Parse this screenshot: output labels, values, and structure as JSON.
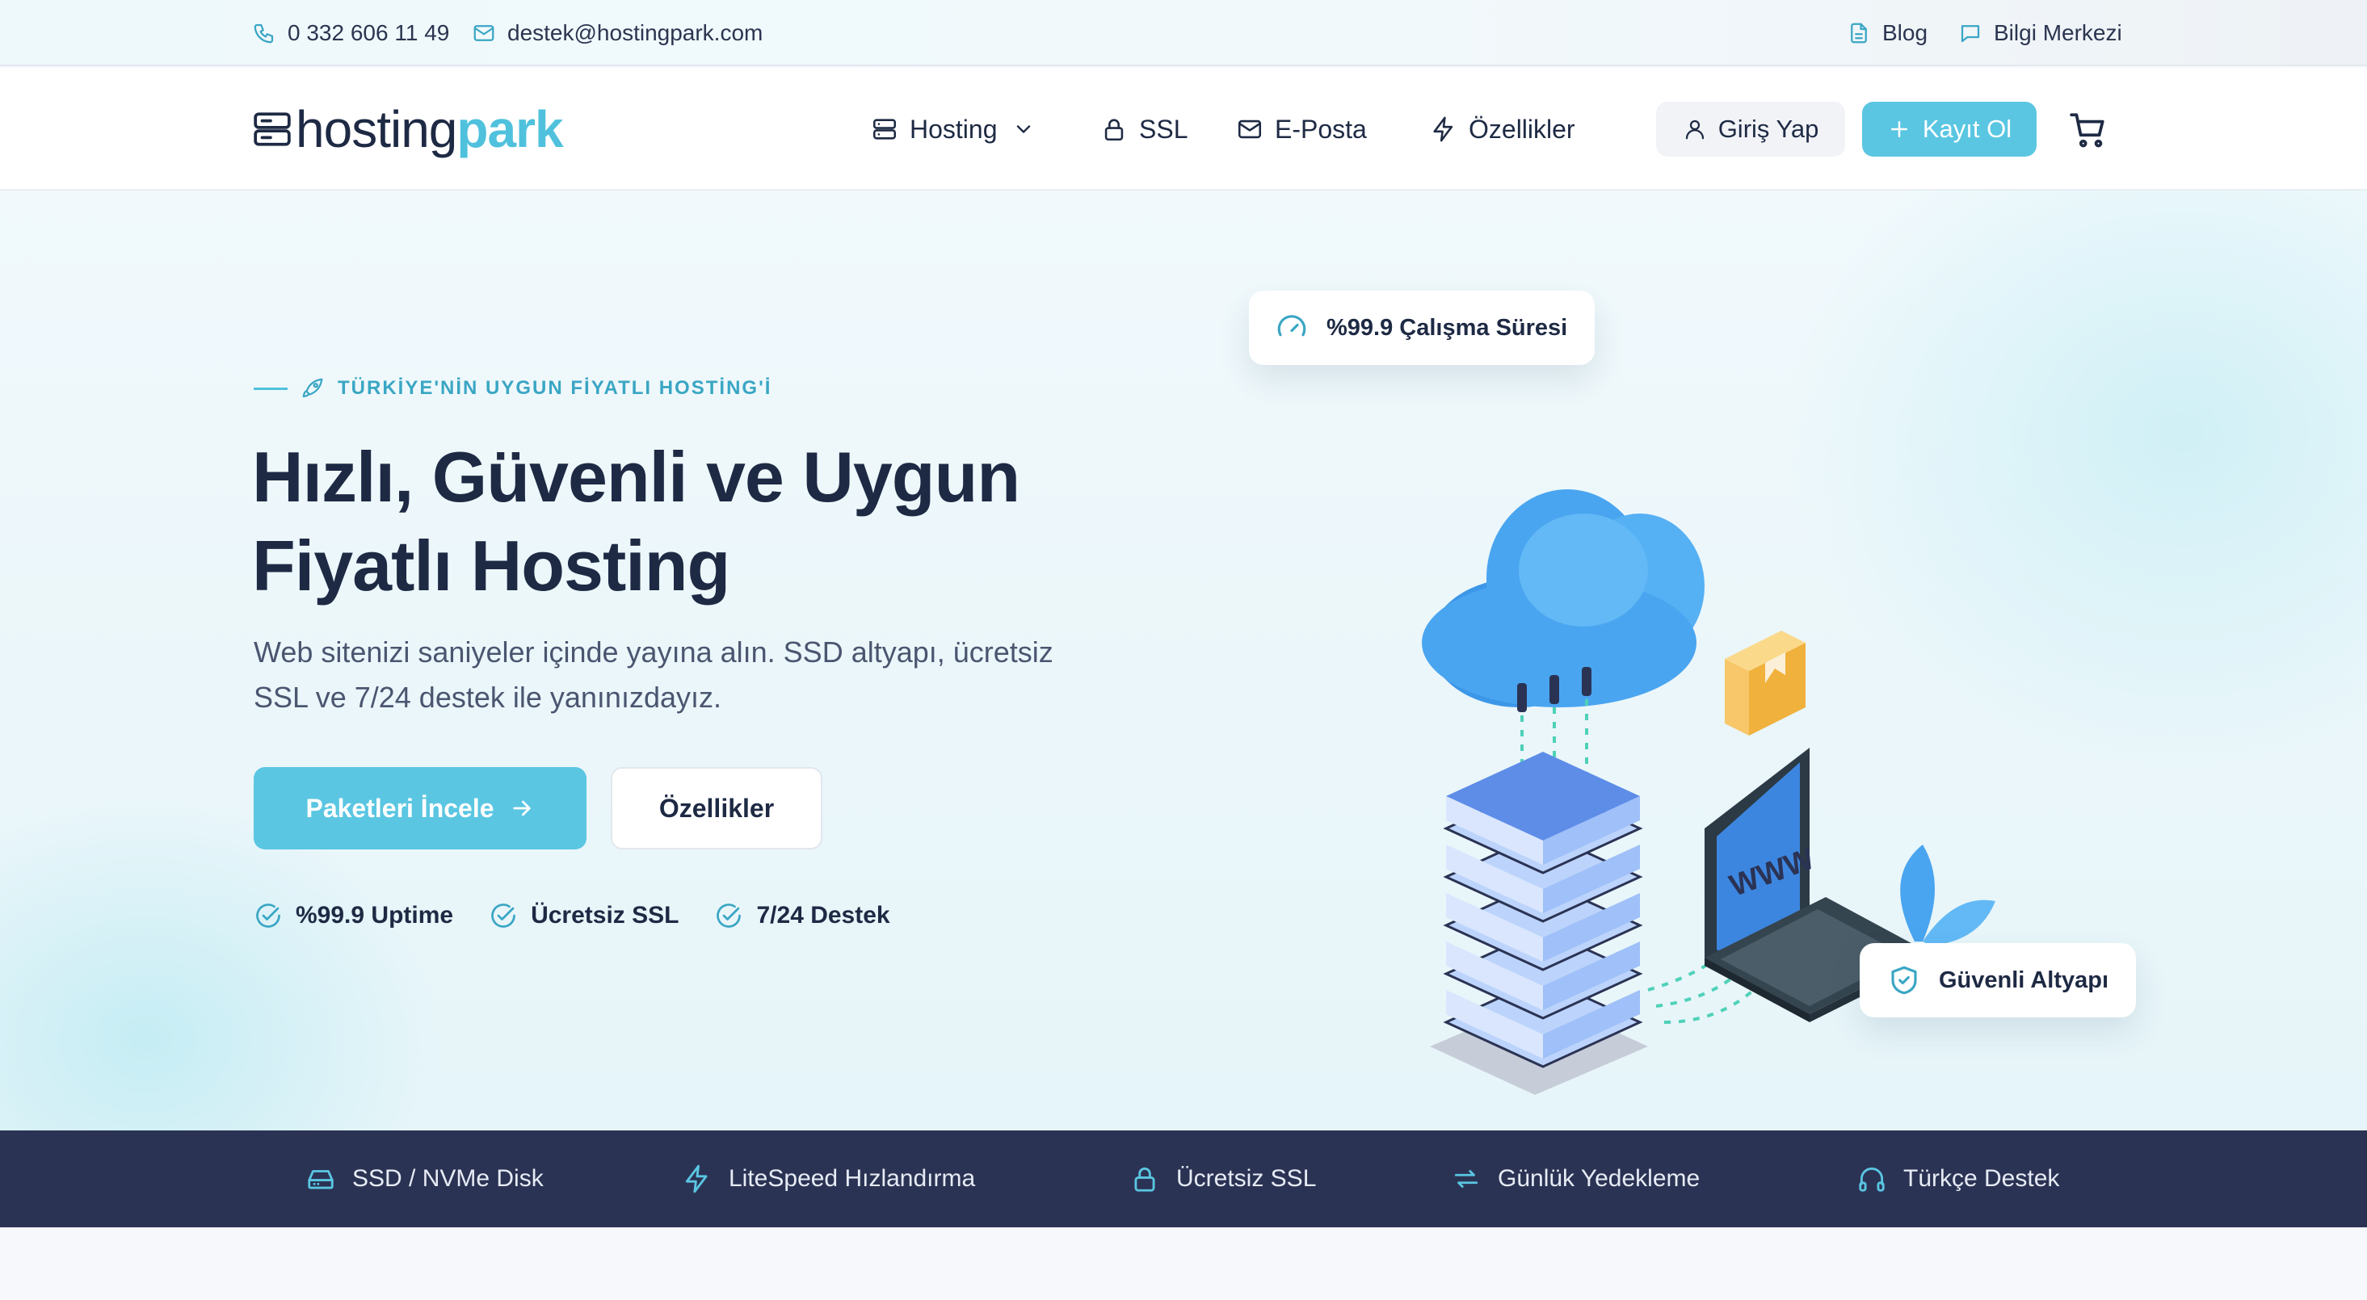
{
  "topbar": {
    "phone": "0 332 606 11 49",
    "email": "destek@hostingpark.com",
    "blog": "Blog",
    "knowledge": "Bilgi Merkezi"
  },
  "logo": {
    "part1": "hosting",
    "part2": "park"
  },
  "nav": {
    "hosting": "Hosting",
    "ssl": "SSL",
    "email": "E-Posta",
    "features": "Özellikler",
    "login": "Giriş Yap",
    "signup": "Kayıt Ol"
  },
  "hero": {
    "eyebrow": "TÜRKİYE'NİN UYGUN FİYATLI HOSTİNG'İ",
    "title_line1": "Hızlı, Güvenli ve Uygun",
    "title_line2": "Fiyatlı Hosting",
    "sub_line1": "Web sitenizi saniyeler içinde yayına alın. SSD altyapı, ücretsiz",
    "sub_line2": "SSL ve 7/24 destek ile yanınızdayız.",
    "primary_btn": "Paketleri İncele",
    "secondary_btn": "Özellikler",
    "features": [
      "%99.9 Uptime",
      "Ücretsiz SSL",
      "7/24 Destek"
    ],
    "badge_uptime": "%99.9 Çalışma Süresi",
    "badge_secure": "Güvenli Altyapı",
    "illustration_text": "WWW"
  },
  "strip": [
    "SSD / NVMe Disk",
    "LiteSpeed Hızlandırma",
    "Ücretsiz SSL",
    "Günlük Yedekleme",
    "Türkçe Destek"
  ],
  "colors": {
    "accent": "#5ac6e2",
    "navy": "#1e2a44",
    "strip": "#2b3354"
  }
}
